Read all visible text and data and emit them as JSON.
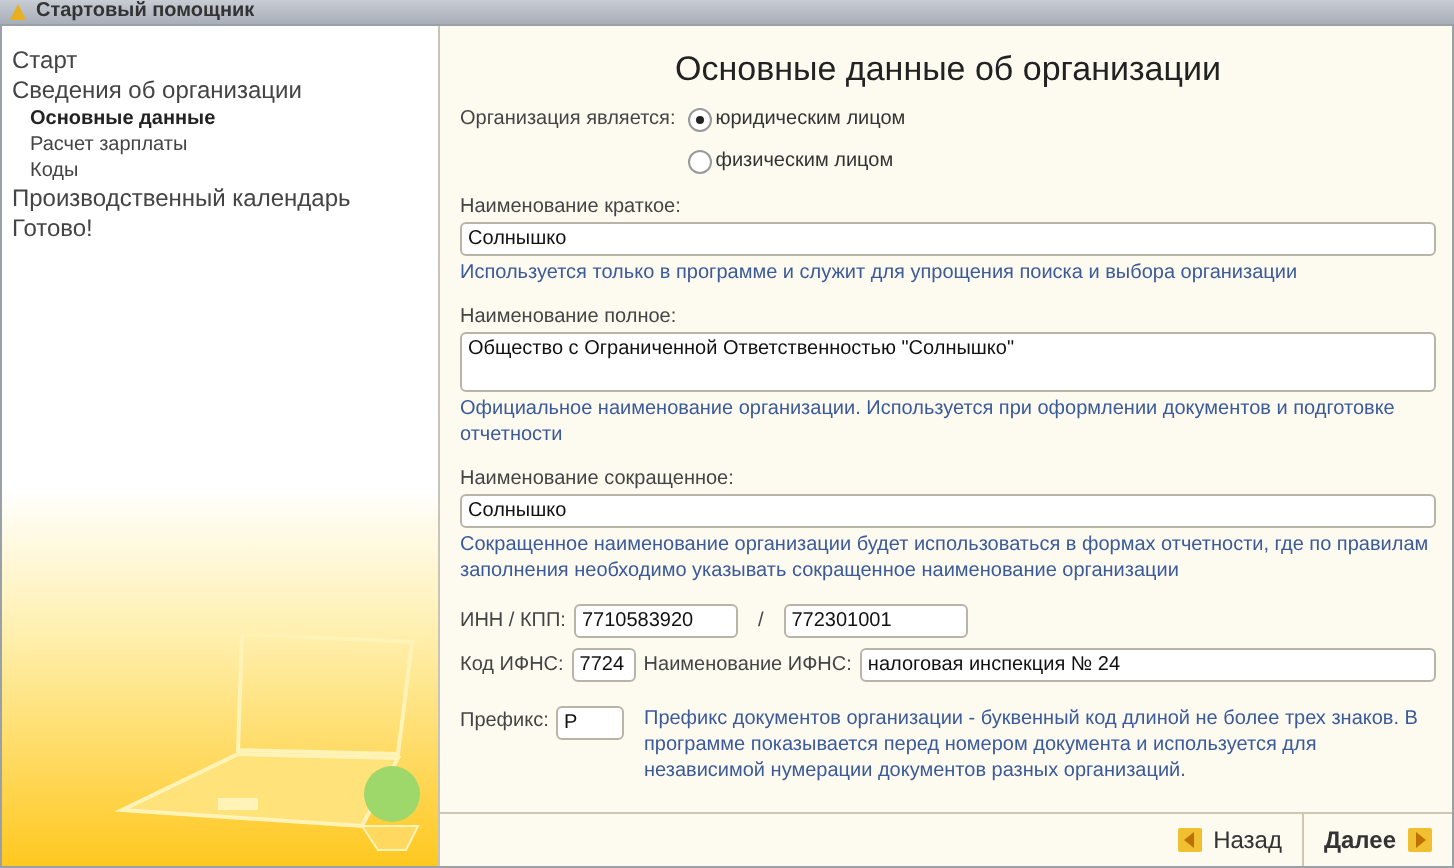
{
  "window": {
    "title": "Стартовый помощник"
  },
  "sidebar": {
    "items": [
      {
        "label": "Старт",
        "selected": false
      },
      {
        "label": "Сведения об организации",
        "selected": false,
        "children": [
          {
            "label": "Основные данные",
            "selected": true
          },
          {
            "label": "Расчет зарплаты",
            "selected": false
          },
          {
            "label": "Коды",
            "selected": false
          }
        ]
      },
      {
        "label": "Производственный календарь",
        "selected": false
      },
      {
        "label": "Готово!",
        "selected": false
      }
    ]
  },
  "heading": "Основные данные об организации",
  "org_type": {
    "label": "Организация является:",
    "options": [
      {
        "label": "юридическим лицом",
        "selected": true
      },
      {
        "label": "физическим лицом",
        "selected": false
      }
    ]
  },
  "name_fields": [
    {
      "label": "Наименование краткое:",
      "value": "Солнышко",
      "hint": "Используется только в программе и служит для упрощения поиска и выбора организации",
      "kind": "line"
    },
    {
      "label": "Наименование полное:",
      "value": "Общество с Ограниченной Ответственностью \"Солнышко\"",
      "hint": "Официальное наименование организации. Используется при оформлении документов и подготовке отчетности",
      "kind": "multi"
    },
    {
      "label": "Наименование сокращенное:",
      "value": "Солнышко",
      "hint": "Сокращенное наименование организации будет использоваться в формах отчетности, где по правилам заполнения необходимо указывать сокращенное наименование организации",
      "kind": "line"
    }
  ],
  "inn_kpp": {
    "label": "ИНН / КПП:",
    "inn": "7710583920",
    "separator": "/",
    "kpp": "772301001"
  },
  "ifns": {
    "code_label": "Код ИФНС:",
    "code": "7724",
    "name_label": "Наименование ИФНС:",
    "name": "налоговая инспекция № 24"
  },
  "prefix": {
    "label": "Префикс:",
    "value": "Р",
    "hint": "Префикс документов организации - буквенный код длиной не более трех знаков. В программе показывается перед номером документа и используется для независимой нумерации документов разных организаций."
  },
  "buttons": [
    {
      "label": "Назад",
      "kind": "back"
    },
    {
      "label": "Далее",
      "kind": "next"
    }
  ]
}
